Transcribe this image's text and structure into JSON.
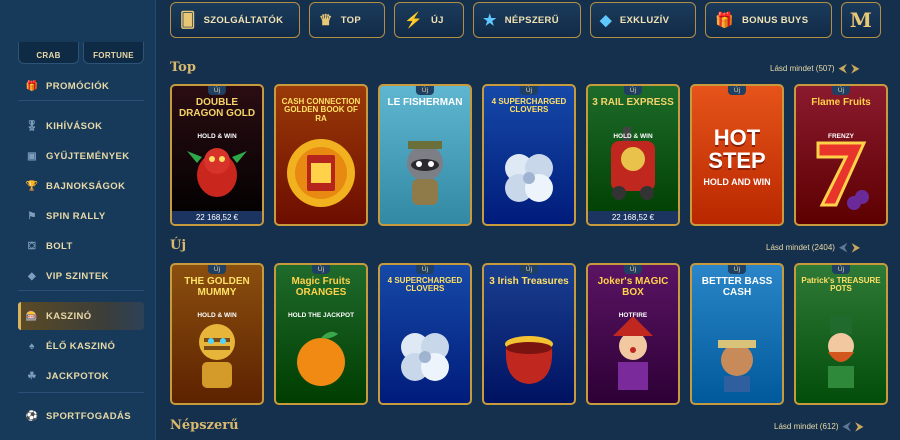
{
  "sidebar": {
    "top_chips": [
      "CRAB",
      "FORTUNE"
    ],
    "items": [
      {
        "label": "PROMÓCIÓK",
        "icon": "gift-icon"
      },
      {
        "label": "KIHÍVÁSOK",
        "icon": "medal-icon"
      },
      {
        "label": "GYŰJTEMÉNYEK",
        "icon": "collection-icon"
      },
      {
        "label": "BAJNOKSÁGOK",
        "icon": "trophy-icon"
      },
      {
        "label": "SPIN RALLY",
        "icon": "rally-icon"
      },
      {
        "label": "BOLT",
        "icon": "shop-icon"
      },
      {
        "label": "VIP SZINTEK",
        "icon": "diamond-icon"
      },
      {
        "label": "KASZINÓ",
        "icon": "slot-machine-icon",
        "active": true
      },
      {
        "label": "ÉLŐ KASZINÓ",
        "icon": "live-casino-icon"
      },
      {
        "label": "JACKPOTOK",
        "icon": "clover-icon"
      },
      {
        "label": "SPORTFOGADÁS",
        "icon": "football-icon"
      }
    ]
  },
  "categories": [
    {
      "label": "SZOLGÁLTATÓK",
      "icon": "card-icon"
    },
    {
      "label": "TOP",
      "icon": "crown-icon"
    },
    {
      "label": "ÚJ",
      "icon": "lightning-icon"
    },
    {
      "label": "NÉPSZERŰ",
      "icon": "star-icon"
    },
    {
      "label": "EXKLUZÍV",
      "icon": "gem-icon"
    },
    {
      "label": "BONUS BUYS",
      "icon": "gift-box-icon"
    },
    {
      "label": "M",
      "icon": "m-logo-icon"
    }
  ],
  "sections": {
    "top": {
      "title": "Top",
      "see_all": "Lásd mindet (507)",
      "games": [
        {
          "badge": "Új",
          "title": "DOUBLE DRAGON GOLD",
          "subtitle": "HOLD & WIN",
          "jackpot": "22 168,52 €",
          "bg": "#2a0d12",
          "title_color": "#f5d36a",
          "art": "dragon"
        },
        {
          "badge": "",
          "title": "CASH CONNECTION GOLDEN BOOK OF RA",
          "subtitle": "",
          "jackpot": "",
          "bg": "#9a3a08",
          "title_color": "#ffe066",
          "art": "book"
        },
        {
          "badge": "Új",
          "title": "LE FISHERMAN",
          "subtitle": "",
          "jackpot": "",
          "bg": "#5fb6d0",
          "title_color": "#ffffff",
          "art": "raccoon"
        },
        {
          "badge": "Új",
          "title": "4 SUPERCHARGED CLOVERS",
          "subtitle": "",
          "jackpot": "",
          "bg": "#1649a8",
          "title_color": "#ffe066",
          "art": "clover"
        },
        {
          "badge": "Új",
          "title": "3 RAIL EXPRESS",
          "subtitle": "HOLD & WIN",
          "jackpot": "22 168,52 €",
          "bg": "#1d6b2a",
          "title_color": "#f5d36a",
          "art": "train"
        },
        {
          "badge": "Új",
          "title": "HOT STEP",
          "subtitle": "HOLD AND WIN",
          "jackpot": "",
          "bg": "#e6541a",
          "title_color": "#ffffff",
          "art": "none"
        },
        {
          "badge": "Új",
          "title": "Flame Fruits",
          "subtitle": "FRENZY",
          "jackpot": "",
          "bg": "#8a1a2e",
          "title_color": "#ffd24a",
          "art": "seven"
        }
      ]
    },
    "uj": {
      "title": "Új",
      "see_all": "Lásd mindet (2404)",
      "games": [
        {
          "badge": "Új",
          "title": "THE GOLDEN MUMMY",
          "subtitle": "HOLD & WIN",
          "jackpot": "",
          "bg": "#8a4f0e",
          "title_color": "#ffe066",
          "art": "mummy"
        },
        {
          "badge": "Új",
          "title": "Magic Fruits ORANGES",
          "subtitle": "HOLD THE JACKPOT",
          "jackpot": "",
          "bg": "#1f6a2c",
          "title_color": "#ffd24a",
          "art": "orange"
        },
        {
          "badge": "Új",
          "title": "4 SUPERCHARGED CLOVERS",
          "subtitle": "",
          "jackpot": "",
          "bg": "#1649a8",
          "title_color": "#ffe066",
          "art": "clover"
        },
        {
          "badge": "Új",
          "title": "3 Irish Treasures",
          "subtitle": "",
          "jackpot": "",
          "bg": "#1a3f8f",
          "title_color": "#ffe066",
          "art": "pot"
        },
        {
          "badge": "Új",
          "title": "Joker's MAGIC BOX",
          "subtitle": "HOTFIRE",
          "jackpot": "",
          "bg": "#5a1463",
          "title_color": "#ffd24a",
          "art": "joker"
        },
        {
          "badge": "Új",
          "title": "BETTER BASS CASH",
          "subtitle": "",
          "jackpot": "",
          "bg": "#2a86c8",
          "title_color": "#ffffff",
          "art": "fisher"
        },
        {
          "badge": "Új",
          "title": "Patrick's TREASURE POTS",
          "subtitle": "",
          "jackpot": "",
          "bg": "#2e7a36",
          "title_color": "#ffe066",
          "art": "leprechaun"
        }
      ]
    },
    "nepszeru": {
      "title": "Népszerű",
      "see_all": "Lásd mindet (612)"
    }
  }
}
